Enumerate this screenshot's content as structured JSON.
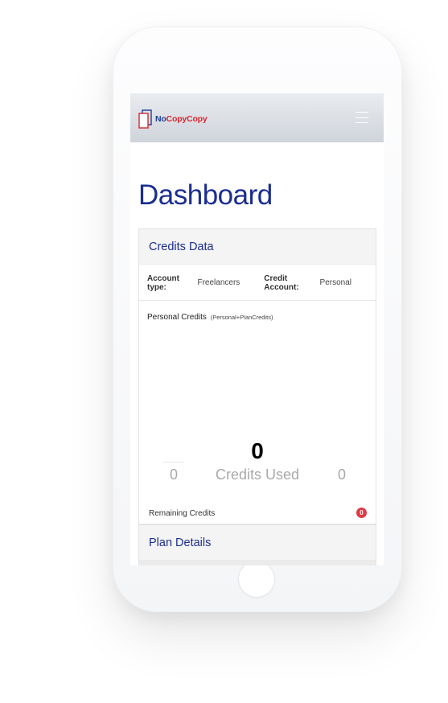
{
  "brand": {
    "name_part1": "No",
    "name_part2": "Copy",
    "name_part3": "Copy",
    "color_primary": "#1f3e9a",
    "color_accent": "#d8262e"
  },
  "navbar": {
    "menu_icon": "hamburger-menu-icon"
  },
  "page": {
    "title": "Dashboard"
  },
  "credits_card": {
    "title": "Credits Data",
    "account_type_label": "Account type:",
    "account_type_value": "Freelancers",
    "credit_account_label": "Credit Account:",
    "credit_account_value": "Personal",
    "personal_credits_label": "Personal Credits",
    "personal_credits_sub": "(Personal+PlanCredits)",
    "credits_used_value": "0",
    "credits_used_label": "Credits Used",
    "left_value": "0",
    "right_value": "0",
    "remaining_label": "Remaining Credits",
    "remaining_badge": "0",
    "badge_color": "#e03a45"
  },
  "plan_card": {
    "title": "Plan Details"
  }
}
